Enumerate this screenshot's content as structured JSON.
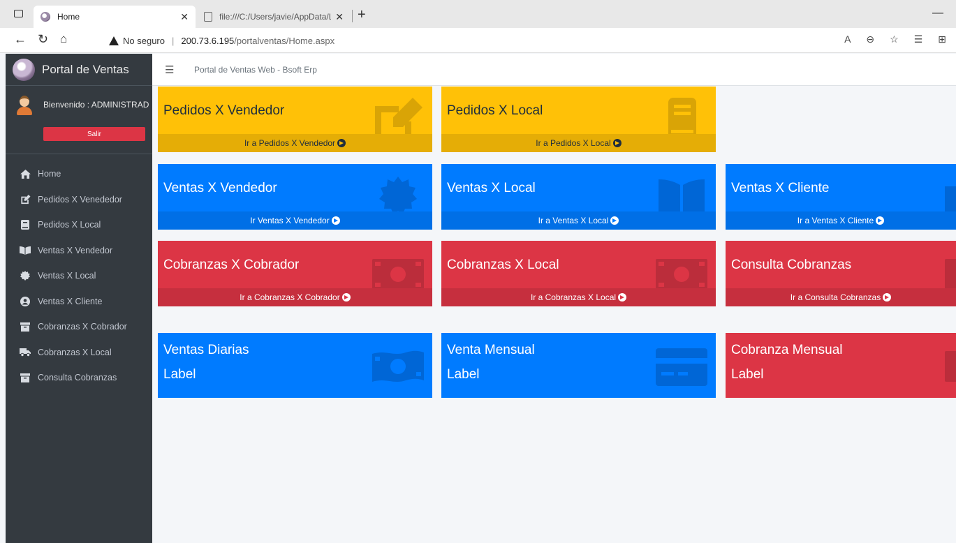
{
  "browser": {
    "tabs": [
      {
        "title": "Home"
      },
      {
        "title": "file:///C:/Users/javie/AppData/Lo"
      }
    ],
    "address": {
      "security": "No seguro",
      "host": "200.73.6.195",
      "path": "/portalventas/Home.aspx"
    }
  },
  "sidebar": {
    "brand": "Portal de Ventas",
    "welcome": "Bienvenido : ADMINISTRAD",
    "logout": "Salir",
    "items": [
      {
        "label": "Home",
        "icon": "home-icon"
      },
      {
        "label": "Pedidos X Venededor",
        "icon": "edit-icon"
      },
      {
        "label": "Pedidos X Local",
        "icon": "book-icon"
      },
      {
        "label": "Ventas X Vendedor",
        "icon": "book-open-icon"
      },
      {
        "label": "Ventas X Local",
        "icon": "certificate-icon"
      },
      {
        "label": "Ventas X Cliente",
        "icon": "user-circle-icon"
      },
      {
        "label": "Cobranzas X Cobrador",
        "icon": "archive-icon"
      },
      {
        "label": "Cobranzas X Local",
        "icon": "truck-icon"
      },
      {
        "label": "Consulta Cobranzas",
        "icon": "archive-icon"
      }
    ]
  },
  "topbar": {
    "title": "Portal de Ventas Web - Bsoft Erp"
  },
  "cards": {
    "pedidos_vendedor": {
      "title": "Pedidos X Vendedor",
      "link": "Ir a Pedidos X Vendedor"
    },
    "pedidos_local": {
      "title": "Pedidos X Local",
      "link": "Ir a Pedidos X Local "
    },
    "ventas_vendedor": {
      "title": "Ventas X Vendedor",
      "link": "Ir Ventas X Vendedor "
    },
    "ventas_local": {
      "title": "Ventas X Local",
      "link": "Ir a Ventas X Local "
    },
    "ventas_cliente": {
      "title": "Ventas X Cliente",
      "link": "Ir a Ventas X Cliente "
    },
    "cobranzas_cobrador": {
      "title": "Cobranzas X Cobrador",
      "link": "Ir a Cobranzas X Cobrador"
    },
    "cobranzas_local": {
      "title": "Cobranzas X Local",
      "link": "Ir a Cobranzas X Local"
    },
    "consulta_cobranzas": {
      "title": "Consulta Cobranzas",
      "link": "Ir a Consulta Cobranzas"
    },
    "ventas_diarias": {
      "title": "Ventas Diarias",
      "value": "Label"
    },
    "venta_mensual": {
      "title": "Venta Mensual",
      "value": "Label"
    },
    "cobranza_mensual": {
      "title": "Cobranza Mensual",
      "value": "Label"
    }
  },
  "colors": {
    "yellow": "#ffc107",
    "blue": "#007bff",
    "red": "#dc3545",
    "sidebar": "#343a40"
  }
}
